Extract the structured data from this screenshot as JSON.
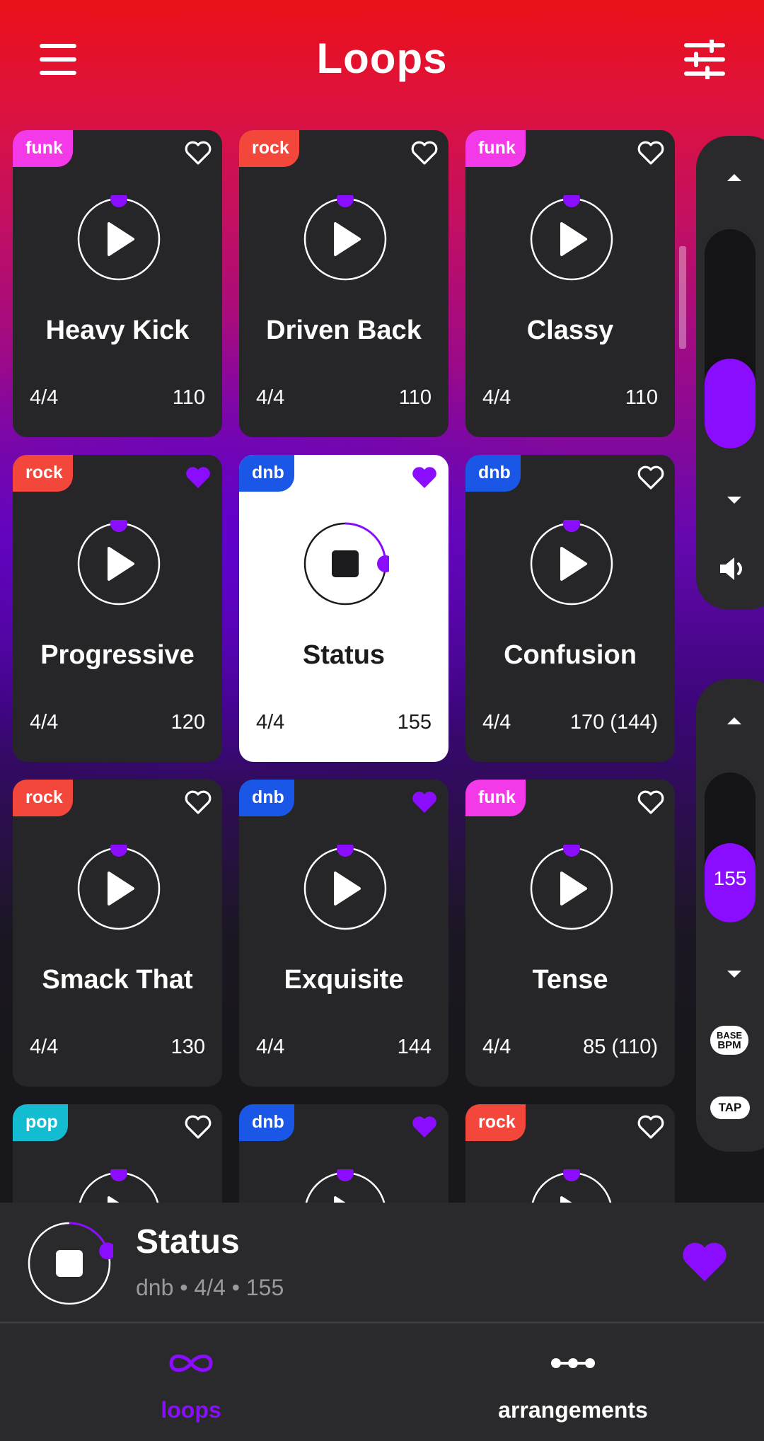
{
  "header": {
    "title": "Loops",
    "menu_icon": "hamburger-menu-icon",
    "filter_icon": "sliders-filter-icon"
  },
  "colors": {
    "accent": "#8a0dff",
    "funk": "#f43ae8",
    "rock": "#f2473a",
    "dnb": "#1b57e6",
    "pop": "#13bcd1",
    "card": "#262528"
  },
  "loops": [
    {
      "genre": "funk",
      "name": "Heavy Kick",
      "meter": "4/4",
      "bpm": "110",
      "favorite": false,
      "playing": false
    },
    {
      "genre": "rock",
      "name": "Driven Back",
      "meter": "4/4",
      "bpm": "110",
      "favorite": false,
      "playing": false
    },
    {
      "genre": "funk",
      "name": "Classy",
      "meter": "4/4",
      "bpm": "110",
      "favorite": false,
      "playing": false
    },
    {
      "genre": "rock",
      "name": "Progressive",
      "meter": "4/4",
      "bpm": "120",
      "favorite": true,
      "playing": false
    },
    {
      "genre": "dnb",
      "name": "Status",
      "meter": "4/4",
      "bpm": "155",
      "favorite": true,
      "playing": true
    },
    {
      "genre": "dnb",
      "name": "Confusion",
      "meter": "4/4",
      "bpm": "170 (144)",
      "favorite": false,
      "playing": false
    },
    {
      "genre": "rock",
      "name": "Smack That",
      "meter": "4/4",
      "bpm": "130",
      "favorite": false,
      "playing": false
    },
    {
      "genre": "dnb",
      "name": "Exquisite",
      "meter": "4/4",
      "bpm": "144",
      "favorite": true,
      "playing": false
    },
    {
      "genre": "funk",
      "name": "Tense",
      "meter": "4/4",
      "bpm": "85 (110)",
      "favorite": false,
      "playing": false
    },
    {
      "genre": "pop",
      "name": "",
      "meter": "",
      "bpm": "",
      "favorite": false,
      "playing": false
    },
    {
      "genre": "dnb",
      "name": "",
      "meter": "",
      "bpm": "",
      "favorite": true,
      "playing": false
    },
    {
      "genre": "rock",
      "name": "",
      "meter": "",
      "bpm": "",
      "favorite": false,
      "playing": false
    }
  ],
  "volume": {
    "level": 0.41,
    "up_icon": "caret-up-icon",
    "down_icon": "caret-down-icon",
    "speaker_icon": "speaker-icon"
  },
  "tempo": {
    "value": "155",
    "level": 0.53,
    "base_bpm_label_1": "BASE",
    "base_bpm_label_2": "BPM",
    "tap_label": "TAP"
  },
  "now_playing": {
    "title": "Status",
    "meta": "dnb • 4/4 • 155",
    "favorite": true,
    "progress": 0.2
  },
  "nav": {
    "loops_label": "loops",
    "arrangements_label": "arrangements",
    "loops_icon": "infinity-icon",
    "arrangements_icon": "dots-line-icon"
  }
}
